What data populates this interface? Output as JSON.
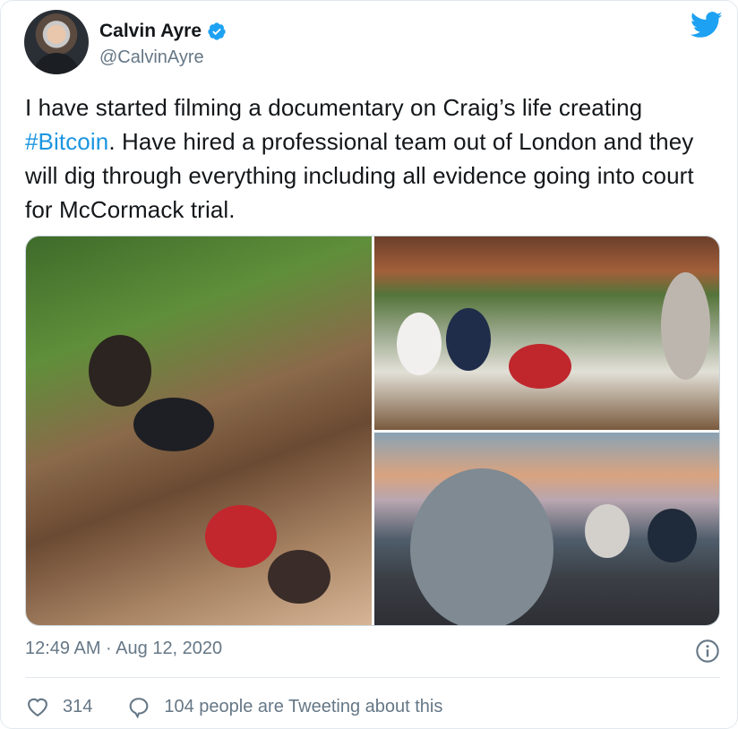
{
  "tweet": {
    "author": {
      "display_name": "Calvin Ayre",
      "handle": "@CalvinAyre",
      "verified": true
    },
    "text_part1": "I have started filming a documentary on Craig’s life creating ",
    "hashtag": "#Bitcoin",
    "text_part2": ".  Have hired a professional team out of London and they will dig through everything including all evidence going into court for McCormack trial.",
    "timestamp": "12:49 AM · Aug 12, 2020",
    "likes_count": "314",
    "conversation_label": "104 people are Tweeting about this"
  },
  "icons": {
    "logo": "twitter-bird-icon",
    "verified": "verified-badge-icon",
    "info": "info-icon",
    "like": "heart-icon",
    "reply": "speech-bubble-icon"
  },
  "colors": {
    "brand": "#1da1f2",
    "hashtag": "#1b95e0",
    "secondary_text": "#657786",
    "primary_text": "#14171a"
  }
}
